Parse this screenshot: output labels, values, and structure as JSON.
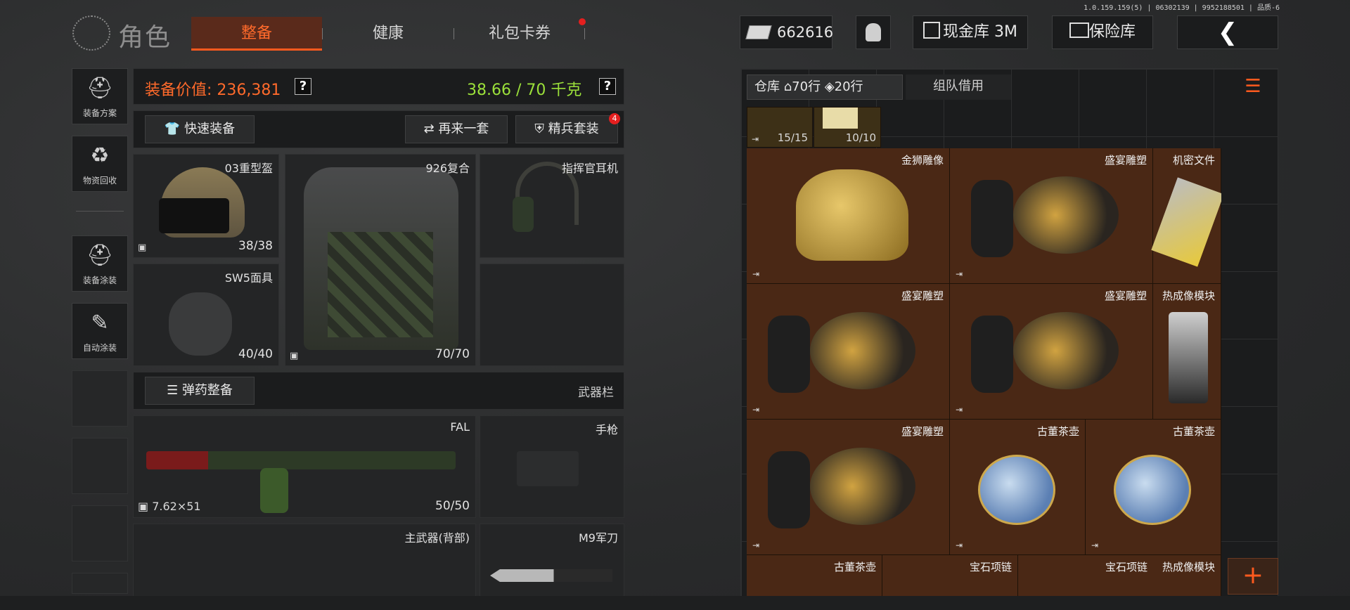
{
  "version": "1.0.159.159(5) | 06302139 | 9952188501 | 品质-6",
  "header": {
    "title": "角色",
    "tabs": [
      "整备",
      "健康",
      "礼包卡券"
    ],
    "currency": "662616",
    "cash_vault": "现金库 3M",
    "safe_box": "保险库",
    "back_glyph": "❮"
  },
  "sidebar": [
    {
      "label": "装备方案",
      "icon": "helmet-grid-icon"
    },
    {
      "label": "物资回收",
      "icon": "recycle-icon"
    },
    {
      "label": "装备涂装",
      "icon": "helmet-paint-icon"
    },
    {
      "label": "自动涂装",
      "icon": "auto-paint-icon"
    }
  ],
  "equip": {
    "value_label": "装备价值: 236,381",
    "weight_label": "38.66 / 70 千克",
    "quick_equip": "快速装备",
    "again_set": "再来一套",
    "elite_set": "精兵套装",
    "elite_badge": "4",
    "slots": {
      "helmet": {
        "name": "03重型盔",
        "count": "38/38"
      },
      "armor": {
        "name": "926复合",
        "count": "70/70"
      },
      "headset": {
        "name": "指挥官耳机"
      },
      "mask": {
        "name": "SW5面具",
        "count": "40/40"
      }
    },
    "ammo_btn": "弹药整备",
    "weapon_bar": "武器栏",
    "primary": {
      "name": "FAL",
      "ammo": "7.62×51",
      "count": "50/50"
    },
    "pistol": {
      "name": "手枪"
    },
    "back_weapon": {
      "name": "主武器(背部)"
    },
    "knife": {
      "name": "M9军刀"
    }
  },
  "warehouse": {
    "tab_label": "仓库",
    "rows_a": "70行",
    "rows_b": "20行",
    "team_borrow": "组队借用",
    "top_items": [
      {
        "count": "15/15"
      },
      {
        "count": "10/10"
      }
    ],
    "items": [
      {
        "name": "金狮雕像"
      },
      {
        "name": "盛宴雕塑"
      },
      {
        "name": "机密文件"
      },
      {
        "name": "盛宴雕塑"
      },
      {
        "name": "盛宴雕塑"
      },
      {
        "name": "热成像模块"
      },
      {
        "name": "盛宴雕塑"
      },
      {
        "name": "古董茶壶"
      },
      {
        "name": "古董茶壶"
      },
      {
        "name": "古董茶壶"
      },
      {
        "name": "宝石项链"
      },
      {
        "name": "宝石项链"
      },
      {
        "name": "热成像模块"
      }
    ],
    "add_glyph": "+"
  },
  "colors": {
    "accent": "#ff5a1e",
    "value": "#ff6a2b",
    "weight": "#9be03a",
    "warehouse_bg": "#4a2815"
  }
}
